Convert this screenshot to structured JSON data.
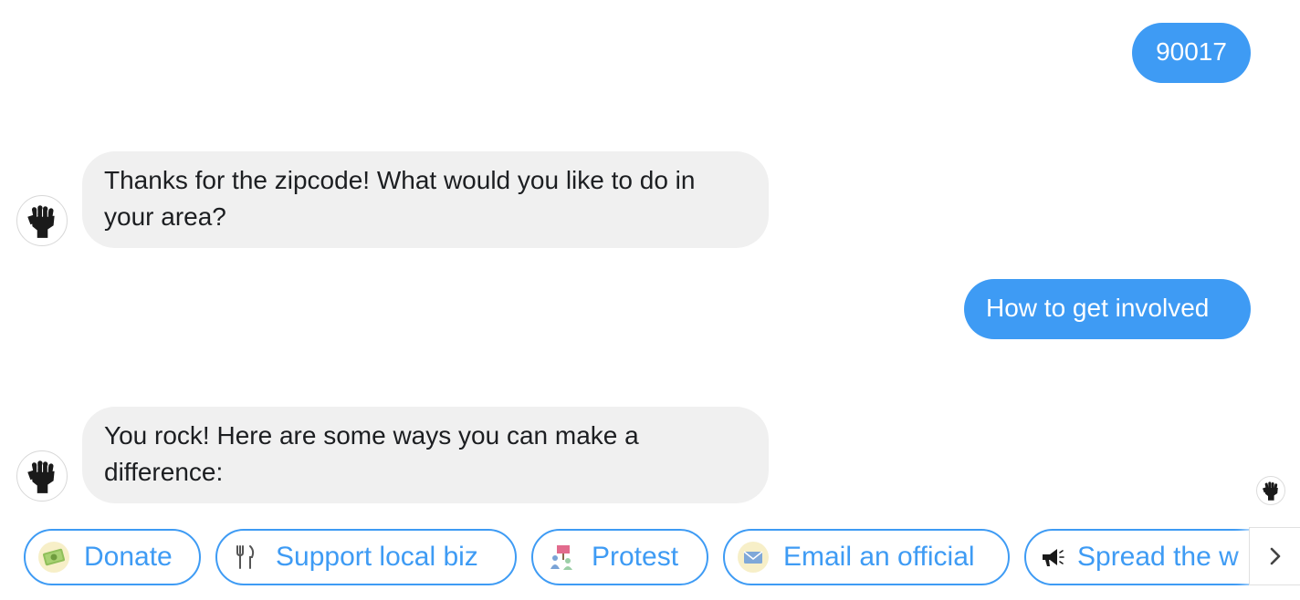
{
  "messages": [
    {
      "from": "user",
      "text": "90017"
    },
    {
      "from": "bot",
      "text": "Thanks for the zipcode! What would you like to do in your area?",
      "avatar_icon": "raised-fist-icon"
    },
    {
      "from": "user",
      "text": "How to get involved"
    },
    {
      "from": "bot",
      "text": "You rock! Here are some ways you can make a difference:",
      "avatar_icon": "raised-fist-icon"
    }
  ],
  "read_receipt": {
    "icon": "raised-fist-icon"
  },
  "quick_replies": [
    {
      "label": "Donate",
      "icon": "money-icon"
    },
    {
      "label": "Support local biz",
      "icon": "fork-knife-icon"
    },
    {
      "label": "Protest",
      "icon": "protest-sign-icon"
    },
    {
      "label": "Email an official",
      "icon": "envelope-icon"
    },
    {
      "label": "Spread the w",
      "icon": "megaphone-icon"
    }
  ],
  "next_button": {
    "icon": "chevron-right-icon"
  },
  "colors": {
    "accent": "#3e9bf4",
    "bot_bubble": "#f0f0f0",
    "text": "#1c1e21"
  }
}
